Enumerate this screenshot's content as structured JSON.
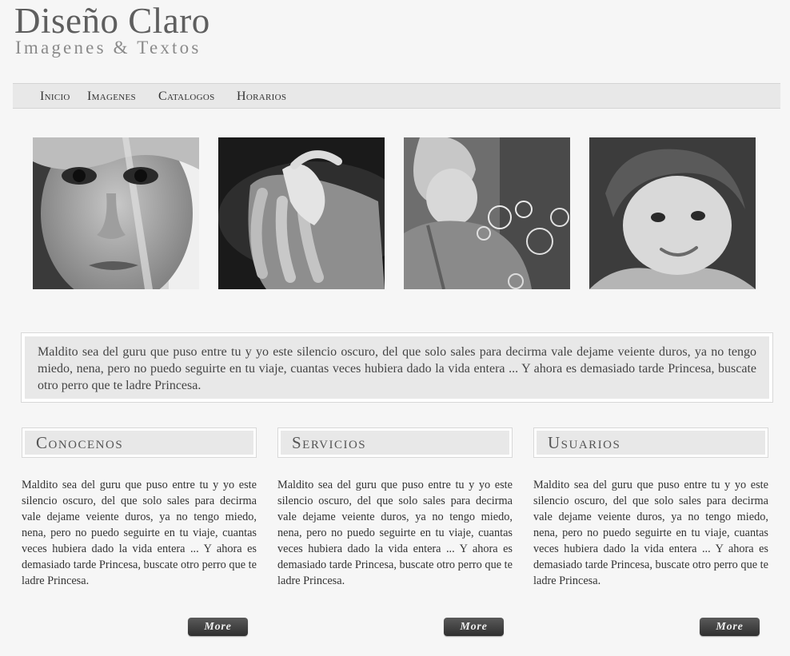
{
  "header": {
    "title": "Diseño Claro",
    "subtitle": "Imagenes & Textos"
  },
  "nav": {
    "items": [
      {
        "label": "Inicio"
      },
      {
        "label": "Imagenes"
      },
      {
        "label": "Catalogos"
      },
      {
        "label": "Horarios"
      }
    ]
  },
  "gallery": [
    {
      "subject": "girl-face-closeup"
    },
    {
      "subject": "child-hand-on-adult-hand"
    },
    {
      "subject": "child-blowing-bubbles"
    },
    {
      "subject": "smiling-child"
    }
  ],
  "intro": {
    "text": "Maldito sea del guru que puso entre tu y yo este silencio oscuro, del que solo sales para decirma vale dejame veiente duros, ya no tengo miedo, nena, pero no puedo seguirte en tu viaje, cuantas veces hubiera dado la vida entera ... Y ahora es demasiado tarde Princesa, buscate otro perro que te ladre Princesa."
  },
  "columns": [
    {
      "heading": "Conocenos",
      "text": "Maldito sea del guru que puso entre tu y yo este silencio oscuro, del que solo sales para decirma vale dejame veiente duros, ya no tengo miedo, nena, pero no puedo seguirte en tu viaje, cuantas veces hubiera dado la vida entera ... Y ahora es demasiado tarde Princesa, buscate otro perro que te ladre Princesa.",
      "button": "More"
    },
    {
      "heading": "Servicios",
      "text": "Maldito sea del guru que puso entre tu y yo este silencio oscuro, del que solo sales para decirma vale dejame veiente duros, ya no tengo miedo, nena, pero no puedo seguirte en tu viaje, cuantas veces hubiera dado la vida entera ... Y ahora es demasiado tarde Princesa, buscate otro perro que te ladre Princesa.",
      "button": "More"
    },
    {
      "heading": "Usuarios",
      "text": "Maldito sea del guru que puso entre tu y yo este silencio oscuro, del que solo sales para decirma vale dejame veiente duros, ya no tengo miedo, nena, pero no puedo seguirte en tu viaje, cuantas veces hubiera dado la vida entera ... Y ahora es demasiado tarde Princesa, buscate otro perro que te ladre Princesa.",
      "button": "More"
    }
  ]
}
